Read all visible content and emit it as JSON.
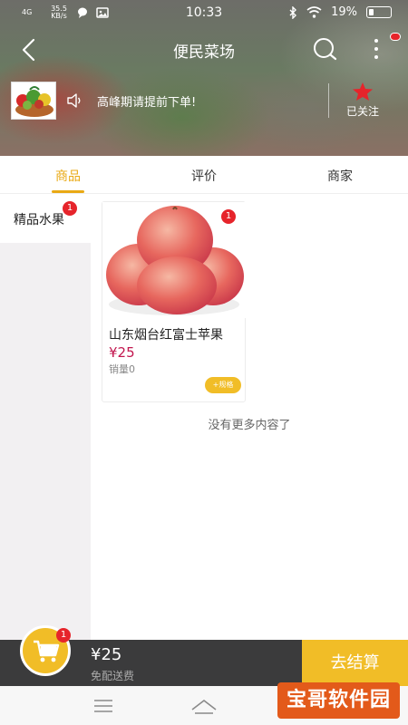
{
  "status_bar": {
    "network": "4G",
    "speed": "35.5",
    "speed_unit": "KB/s",
    "time": "10:33",
    "battery": "19%"
  },
  "header": {
    "title": "便民菜场"
  },
  "store": {
    "notice": "高峰期请提前下单!",
    "follow_label": "已关注"
  },
  "tabs": [
    {
      "label": "商品",
      "active": true
    },
    {
      "label": "评价",
      "active": false
    },
    {
      "label": "商家",
      "active": false
    }
  ],
  "categories": [
    {
      "label": "精品水果",
      "badge": "1"
    }
  ],
  "products": [
    {
      "name": "山东烟台红富士苹果",
      "price": "¥25",
      "sales": "销量0",
      "badge": "1",
      "spec_button": "+规格"
    }
  ],
  "list_end_text": "没有更多内容了",
  "cart": {
    "badge": "1",
    "total": "¥25",
    "delivery_note": "免配送费",
    "checkout_label": "去结算"
  },
  "watermark": "宝哥软件园",
  "colors": {
    "accent": "#e9a914",
    "price": "#c2164e",
    "badge": "#e6242b",
    "cart_bar": "#3b3b3c",
    "checkout": "#f1bd27"
  }
}
